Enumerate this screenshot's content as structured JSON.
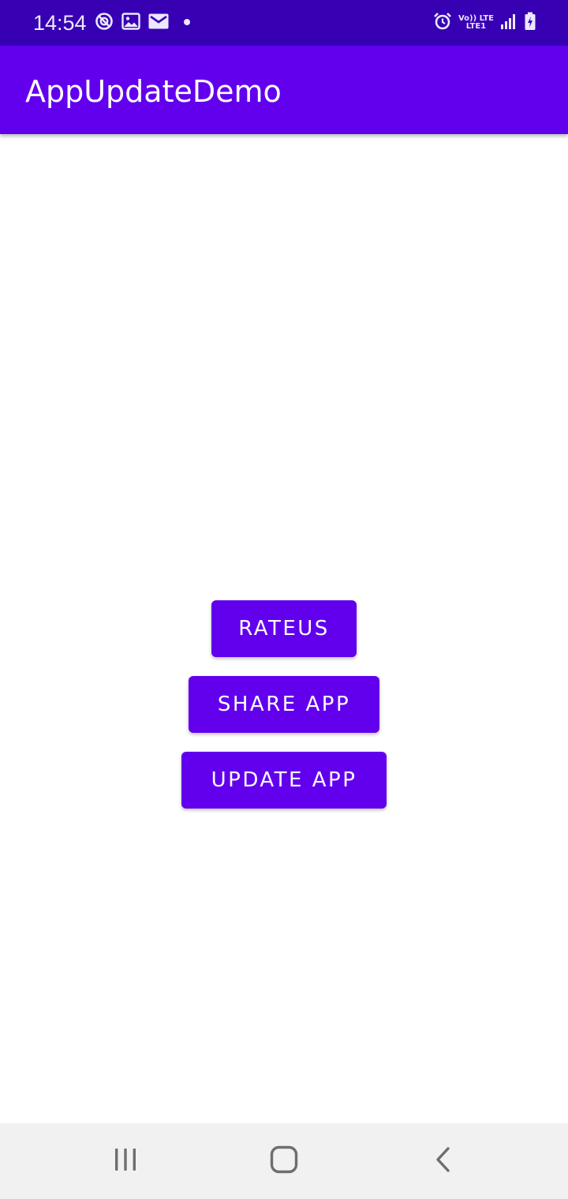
{
  "status_bar": {
    "time": "14:54",
    "network_top": "Vo)) LTE",
    "network_bottom": "LTE1",
    "icons": [
      "data-saver-icon",
      "image-icon",
      "mail-icon",
      "notification-dot-icon",
      "alarm-icon",
      "signal-icon",
      "battery-charging-icon"
    ]
  },
  "app_bar": {
    "title": "AppUpdateDemo"
  },
  "buttons": {
    "rate_label": "RATEUS",
    "share_label": "SHARE APP",
    "update_label": "UPDATE APP"
  },
  "nav_bar": {
    "icons": [
      "recents-icon",
      "home-icon",
      "back-icon"
    ]
  },
  "colors": {
    "status_bar": "#3700b3",
    "primary": "#6200ee",
    "nav_bar": "#f1f1f1",
    "background": "#ffffff"
  }
}
